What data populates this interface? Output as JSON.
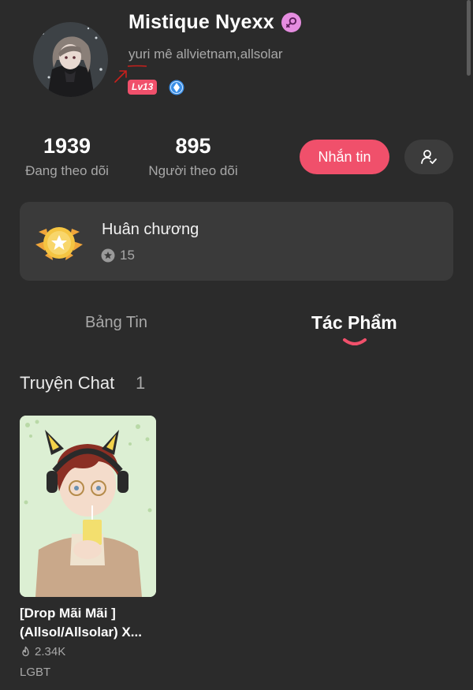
{
  "profile": {
    "name": "Mistique Nyexx",
    "bio": "yuri mê allvietnam,allsolar",
    "level": "Lv13",
    "gender_icon": "female-symbol-icon",
    "avatar_icon": "avatar-anime-girl"
  },
  "stats": {
    "following_count": "1939",
    "following_label": "Đang theo dõi",
    "followers_count": "895",
    "followers_label": "Người theo dõi"
  },
  "actions": {
    "message_label": "Nhắn tin",
    "follow_icon": "user-check-icon"
  },
  "medals": {
    "title": "Huân chương",
    "count": "15"
  },
  "tabs": {
    "feed": "Bảng Tin",
    "works": "Tác Phẩm",
    "active": "works"
  },
  "section": {
    "title": "Truyện Chat",
    "count": "1"
  },
  "stories": [
    {
      "title_line1": "[Drop Mãi Mãi ]",
      "title_line2": "(Allsol/Allsolar) X...",
      "views": "2.34K",
      "tag": "LGBT"
    }
  ],
  "colors": {
    "background": "#2b2b2b",
    "accent": "#f0506b",
    "card": "#3a3a3a",
    "muted_text": "#a8a8a8"
  }
}
